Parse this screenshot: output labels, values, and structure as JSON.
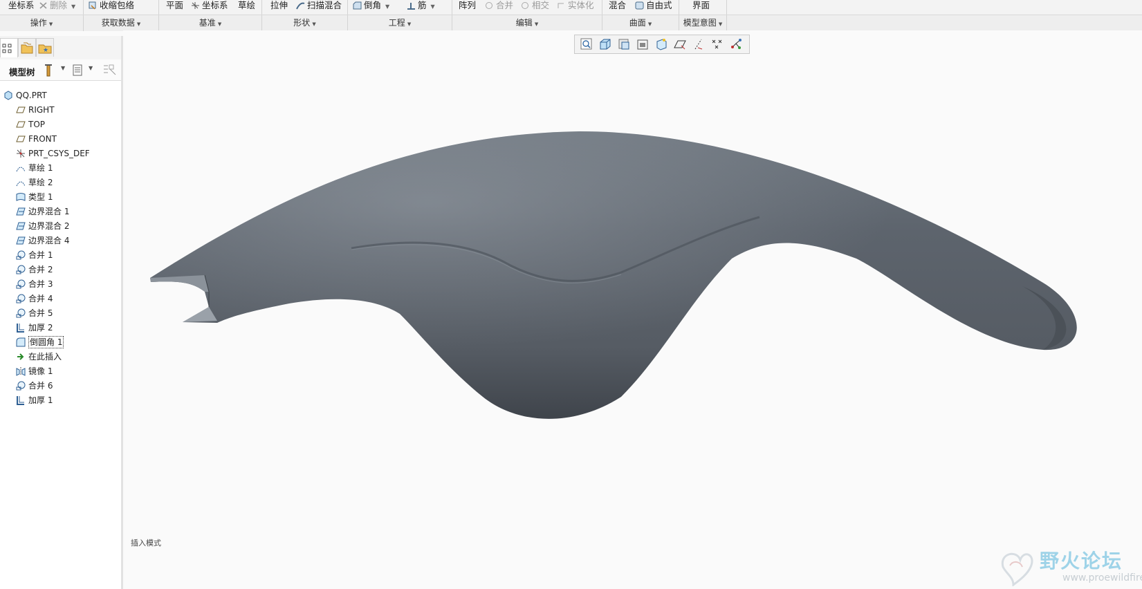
{
  "ribbon": {
    "tools": [
      {
        "label": "坐标系",
        "icon": "coordinate-system-icon",
        "disabled": false
      },
      {
        "label": "删除",
        "icon": "delete-icon",
        "disabled": true
      },
      {
        "label": "收缩包络",
        "icon": "shrinkwrap-icon",
        "disabled": false
      },
      {
        "label": "平面",
        "icon": "plane-icon",
        "disabled": false
      },
      {
        "label": "坐标系",
        "icon": "csys-icon",
        "disabled": false
      },
      {
        "label": "草绘",
        "icon": "sketch-icon",
        "disabled": false
      },
      {
        "label": "拉伸",
        "icon": "extrude-icon",
        "disabled": false
      },
      {
        "label": "扫描混合",
        "icon": "swept-blend-icon",
        "disabled": false
      },
      {
        "label": "倒角",
        "icon": "chamfer-icon",
        "disabled": false
      },
      {
        "label": "筋",
        "icon": "rib-icon",
        "disabled": false
      },
      {
        "label": "阵列",
        "icon": "pattern-icon",
        "disabled": false
      },
      {
        "label": "合并",
        "icon": "merge-icon",
        "disabled": true
      },
      {
        "label": "相交",
        "icon": "intersect-icon",
        "disabled": true
      },
      {
        "label": "实体化",
        "icon": "solidify-icon",
        "disabled": true
      },
      {
        "label": "混合",
        "icon": "blend-icon",
        "disabled": false
      },
      {
        "label": "自由式",
        "icon": "freestyle-icon",
        "disabled": false
      },
      {
        "label": "界面",
        "icon": "interface-icon",
        "disabled": false
      }
    ],
    "groups": [
      "操作",
      "获取数据",
      "基准",
      "形状",
      "工程",
      "编辑",
      "曲面",
      "模型意图"
    ]
  },
  "panel": {
    "tabs": [
      "model-tree-tab-icon",
      "folder-browser-tab-icon",
      "favorites-tab-icon"
    ],
    "tree_title": "模型树",
    "tree_items": [
      {
        "label": "QQ.PRT",
        "icon": "part-icon",
        "indent": 0
      },
      {
        "label": "RIGHT",
        "icon": "datum-plane-icon",
        "indent": 1
      },
      {
        "label": "TOP",
        "icon": "datum-plane-icon",
        "indent": 1
      },
      {
        "label": "FRONT",
        "icon": "datum-plane-icon",
        "indent": 1
      },
      {
        "label": "PRT_CSYS_DEF",
        "icon": "csys-icon",
        "indent": 1
      },
      {
        "label": "草绘 1",
        "icon": "sketch-icon",
        "indent": 1
      },
      {
        "label": "草绘 2",
        "icon": "sketch-icon",
        "indent": 1
      },
      {
        "label": "类型 1",
        "icon": "surface-icon",
        "indent": 1
      },
      {
        "label": "边界混合 1",
        "icon": "boundary-blend-icon",
        "indent": 1
      },
      {
        "label": "边界混合 2",
        "icon": "boundary-blend-icon",
        "indent": 1
      },
      {
        "label": "边界混合 4",
        "icon": "boundary-blend-icon",
        "indent": 1
      },
      {
        "label": "合并 1",
        "icon": "merge-icon",
        "indent": 1
      },
      {
        "label": "合并 2",
        "icon": "merge-icon",
        "indent": 1
      },
      {
        "label": "合并 3",
        "icon": "merge-icon",
        "indent": 1
      },
      {
        "label": "合并 4",
        "icon": "merge-icon",
        "indent": 1
      },
      {
        "label": "合并 5",
        "icon": "merge-icon",
        "indent": 1
      },
      {
        "label": "加厚 2",
        "icon": "thicken-icon",
        "indent": 1
      },
      {
        "label": "倒圆角 1",
        "icon": "round-icon",
        "indent": 1
      },
      {
        "label": "在此插入",
        "icon": "insert-here-arrow-icon",
        "indent": 1
      },
      {
        "label": "镜像 1",
        "icon": "mirror-icon",
        "indent": 1
      },
      {
        "label": "合并 6",
        "icon": "merge-icon",
        "indent": 1
      },
      {
        "label": "加厚 1",
        "icon": "thicken-icon",
        "indent": 1
      }
    ]
  },
  "viewtoolbar": {
    "buttons": [
      "refit-icon",
      "saved-orientations-icon",
      "display-style-icon",
      "view-manager-icon",
      "datum-display-icon",
      "plane-display-icon",
      "axis-display-icon",
      "point-display-icon",
      "csys-display-icon"
    ]
  },
  "graphics": {
    "status_text": "插入模式",
    "model_color": "#5f6670"
  },
  "watermark": {
    "title": "野火论坛",
    "url": "www.proewildfire.cn"
  }
}
